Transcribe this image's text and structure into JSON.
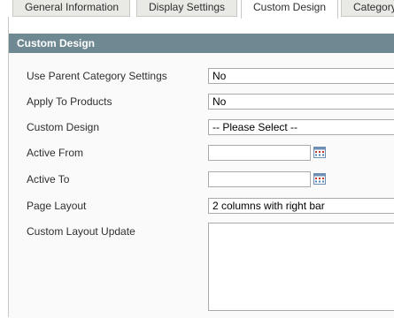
{
  "tabs": [
    {
      "label": "General Information"
    },
    {
      "label": "Display Settings"
    },
    {
      "label": "Custom Design"
    },
    {
      "label": "Category"
    }
  ],
  "section": {
    "title": "Custom Design"
  },
  "form": {
    "use_parent": {
      "label": "Use Parent Category Settings",
      "value": "No"
    },
    "apply_products": {
      "label": "Apply To Products",
      "value": "No"
    },
    "custom_design": {
      "label": "Custom Design",
      "value": "-- Please Select --"
    },
    "active_from": {
      "label": "Active From",
      "value": ""
    },
    "active_to": {
      "label": "Active To",
      "value": ""
    },
    "page_layout": {
      "label": "Page Layout",
      "value": "2 columns with right bar"
    },
    "layout_update": {
      "label": "Custom Layout Update",
      "value": ""
    }
  },
  "icons": {
    "calendar": "calendar-icon"
  },
  "colors": {
    "header_bg": "#6f8992",
    "tab_bg": "#e9e9e6"
  }
}
